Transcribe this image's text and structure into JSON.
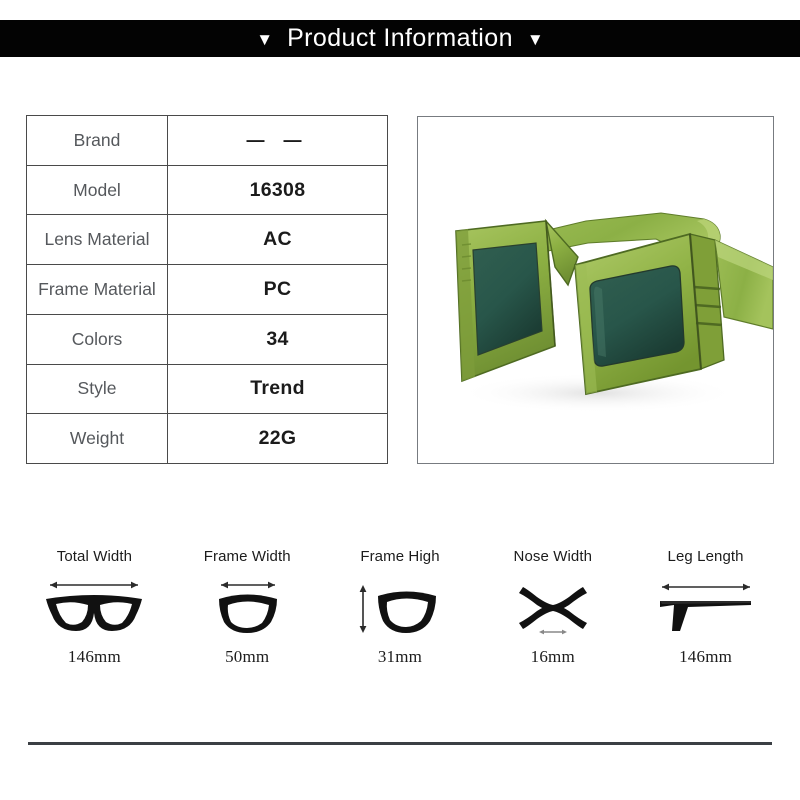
{
  "header": {
    "title": "Product Information",
    "left_marker": "▼",
    "right_marker": "▼"
  },
  "spec_table": {
    "rows": [
      {
        "label": "Brand",
        "value": "— —"
      },
      {
        "label": "Model",
        "value": "16308"
      },
      {
        "label": "Lens Material",
        "value": "AC"
      },
      {
        "label": "Frame Material",
        "value": "PC"
      },
      {
        "label": "Colors",
        "value": "34"
      },
      {
        "label": "Style",
        "value": "Trend"
      },
      {
        "label": "Weight",
        "value": "22G"
      }
    ]
  },
  "product_image": {
    "alt": "green rectangular sunglasses",
    "frame_color": "#8fae4a",
    "frame_light": "#a8c45f",
    "frame_dark": "#6b8a34",
    "lens_color": "#2a5548",
    "lens_dark": "#1d4036",
    "outline_color": "#3d4f22"
  },
  "measurements": [
    {
      "label": "Total Width",
      "value": "146mm",
      "icon": "full-glasses-width-icon"
    },
    {
      "label": "Frame Width",
      "value": "50mm",
      "icon": "single-lens-width-icon"
    },
    {
      "label": "Frame High",
      "value": "31mm",
      "icon": "single-lens-height-icon"
    },
    {
      "label": "Nose Width",
      "value": "16mm",
      "icon": "nose-bridge-icon"
    },
    {
      "label": "Leg Length",
      "value": "146mm",
      "icon": "temple-arm-icon"
    }
  ]
}
